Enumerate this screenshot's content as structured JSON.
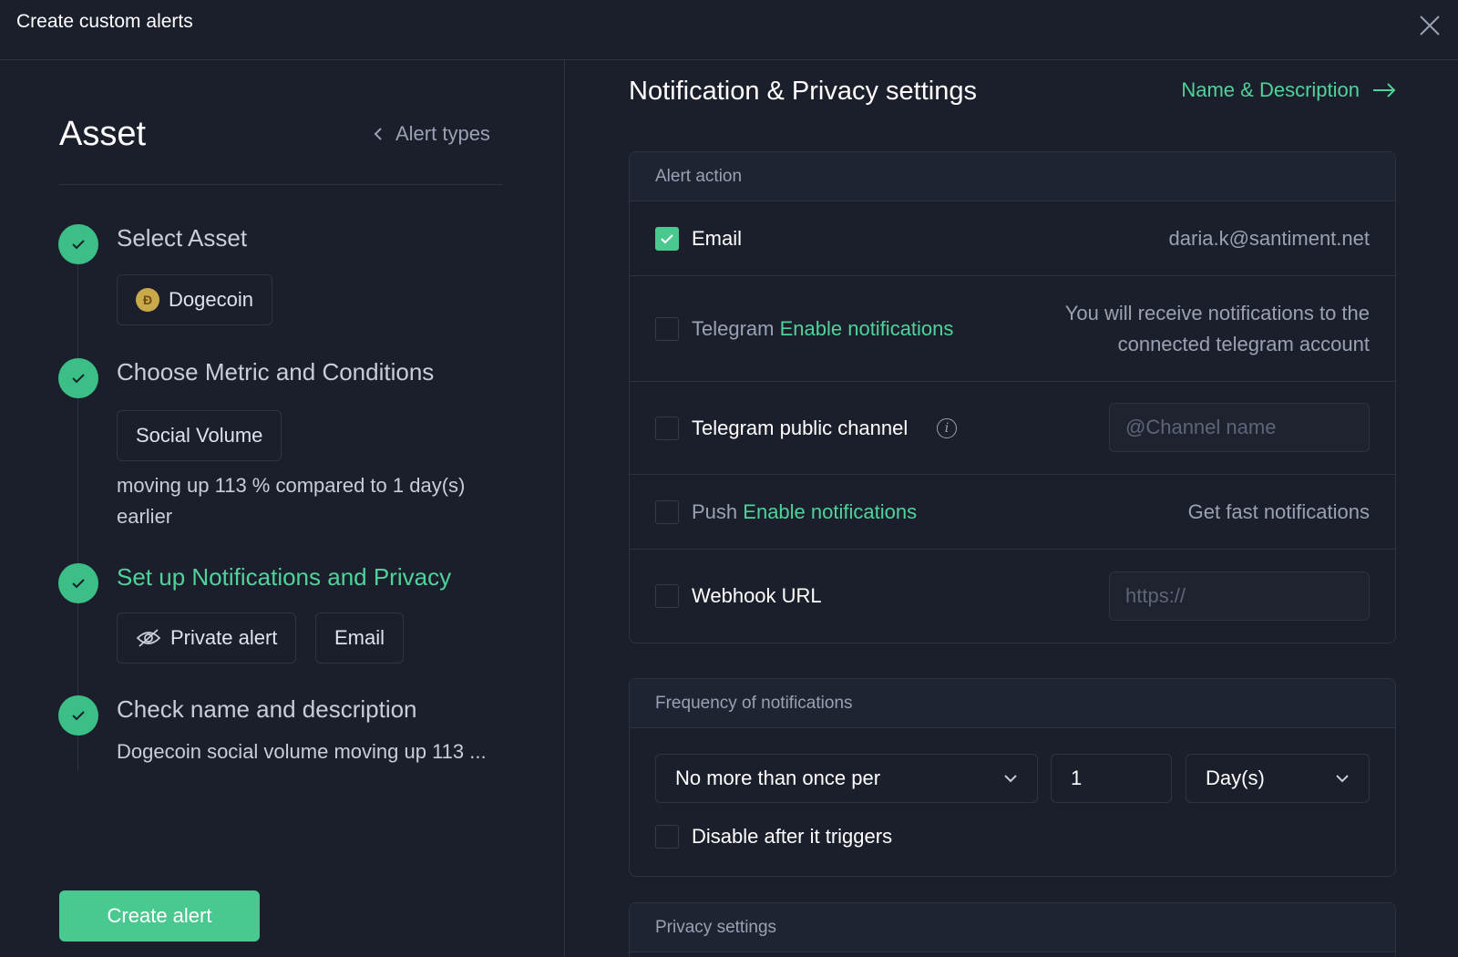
{
  "window": {
    "title": "Create custom alerts",
    "close_icon": "close-icon"
  },
  "sidebar": {
    "section_title": "Asset",
    "back_link": "Alert types",
    "steps": [
      {
        "label": "Select Asset",
        "chips": [
          "Dogecoin"
        ],
        "coin_glyph": "Ð"
      },
      {
        "label": "Choose Metric and Conditions",
        "chips": [
          "Social Volume"
        ],
        "description": "moving up 113 % compared to 1 day(s) earlier"
      },
      {
        "label": "Set up Notifications and Privacy",
        "chips": [
          "Private alert",
          "Email"
        ]
      },
      {
        "label": "Check name and description",
        "description": "Dogecoin social volume moving up 113 ..."
      }
    ],
    "create_button": "Create alert"
  },
  "main": {
    "title": "Notification & Privacy settings",
    "next_link": "Name & Description",
    "alert_action": {
      "header": "Alert action",
      "email": {
        "label": "Email",
        "value": "daria.k@santiment.net",
        "checked": true
      },
      "telegram": {
        "label": "Telegram",
        "link": "Enable notifications",
        "note_line1": "You will receive notifications to the",
        "note_line2": "connected telegram account",
        "checked": false
      },
      "telegram_channel": {
        "label": "Telegram public channel",
        "placeholder": "@Channel name",
        "checked": false
      },
      "push": {
        "label": "Push",
        "link": "Enable notifications",
        "note": "Get fast notifications",
        "checked": false
      },
      "webhook": {
        "label": "Webhook URL",
        "placeholder": "https://",
        "checked": false
      }
    },
    "frequency": {
      "header": "Frequency of notifications",
      "mode": "No more than once per",
      "count": "1",
      "unit": "Day(s)",
      "disable_label": "Disable after it triggers",
      "disable_checked": false
    },
    "privacy": {
      "header": "Privacy settings"
    }
  },
  "colors": {
    "accent": "#49c98f",
    "background": "#1b1f2c",
    "border": "#2c3242"
  }
}
